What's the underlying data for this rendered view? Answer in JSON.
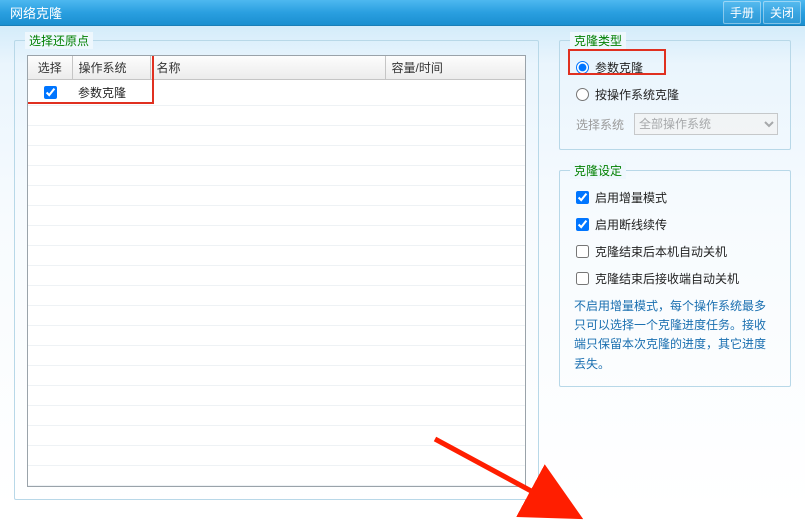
{
  "window": {
    "title": "网络克隆",
    "manual_btn": "手册",
    "close_btn": "关闭"
  },
  "restore": {
    "legend": "选择还原点",
    "columns": {
      "select": "选择",
      "os": "操作系统",
      "name": "名称",
      "capacity": "容量/时间"
    },
    "rows": [
      {
        "checked": true,
        "os": "参数克隆",
        "name": "",
        "capacity": ""
      }
    ]
  },
  "clone_type": {
    "legend": "克隆类型",
    "opt_param": "参数克隆",
    "opt_by_os": "按操作系统克隆",
    "select_sys_label": "选择系统",
    "select_sys_value": "全部操作系统"
  },
  "clone_settings": {
    "legend": "克隆设定",
    "incremental": "启用增量模式",
    "resume": "启用断线续传",
    "shutdown_local": "克隆结束后本机自动关机",
    "shutdown_receiver": "克隆结束后接收端自动关机",
    "note": "不启用增量模式，每个操作系统最多只可以选择一个克隆进度任务。接收端只保留本次克隆的进度，其它进度丢失。"
  }
}
